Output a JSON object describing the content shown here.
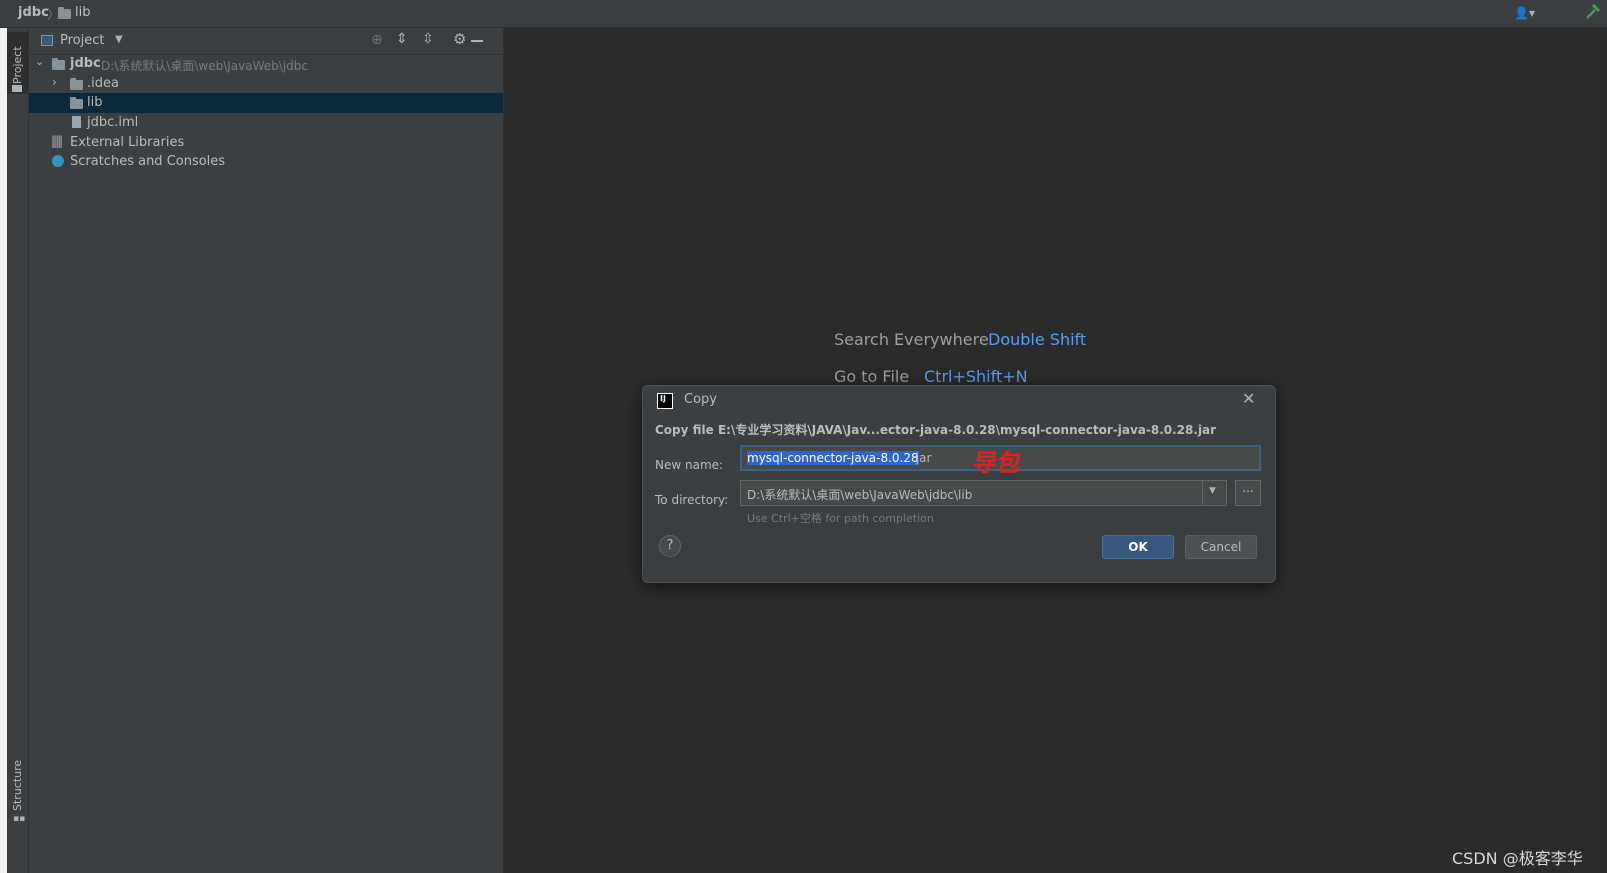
{
  "navbar": {
    "crumb_project": "jdbc",
    "crumb_folder": "lib"
  },
  "toolstripe": {
    "project_label": "Project",
    "structure_label": "Structure"
  },
  "project_panel": {
    "title": "Project",
    "tree": [
      {
        "label": "jdbc",
        "path": "D:\\系统默认\\桌面\\web\\JavaWeb\\jdbc"
      },
      {
        "label": ".idea"
      },
      {
        "label": "lib"
      },
      {
        "label": "jdbc.iml"
      },
      {
        "label": "External Libraries"
      },
      {
        "label": "Scratches and Consoles"
      }
    ]
  },
  "editor": {
    "hint_label": "Search Everywhere",
    "hint_shortcut": "Double Shift",
    "hint2_label": "Go to File",
    "hint2_shortcut": "Ctrl+Shift+N"
  },
  "dialog": {
    "title": "Copy",
    "heading": "Copy file E:\\专业学习资料\\JAVA\\Jav...ector-java-8.0.28\\mysql-connector-java-8.0.28.jar",
    "new_name_label": "New name:",
    "new_name_selected": "mysql-connector-java-8.0.28",
    "new_name_rest": ".jar",
    "annotation": "导包",
    "to_dir_label": "To directory:",
    "to_dir_value": "D:\\系统默认\\桌面\\web\\JavaWeb\\jdbc\\lib",
    "browse_label": "...",
    "hint": "Use Ctrl+空格 for path completion",
    "help_label": "?",
    "ok_label": "OK",
    "cancel_label": "Cancel"
  },
  "watermark": "CSDN @极客李华",
  "colors": {
    "accent": "#589df6",
    "selection": "#0d293e",
    "ok_button": "#365880",
    "annotation_red": "#e0201b"
  }
}
